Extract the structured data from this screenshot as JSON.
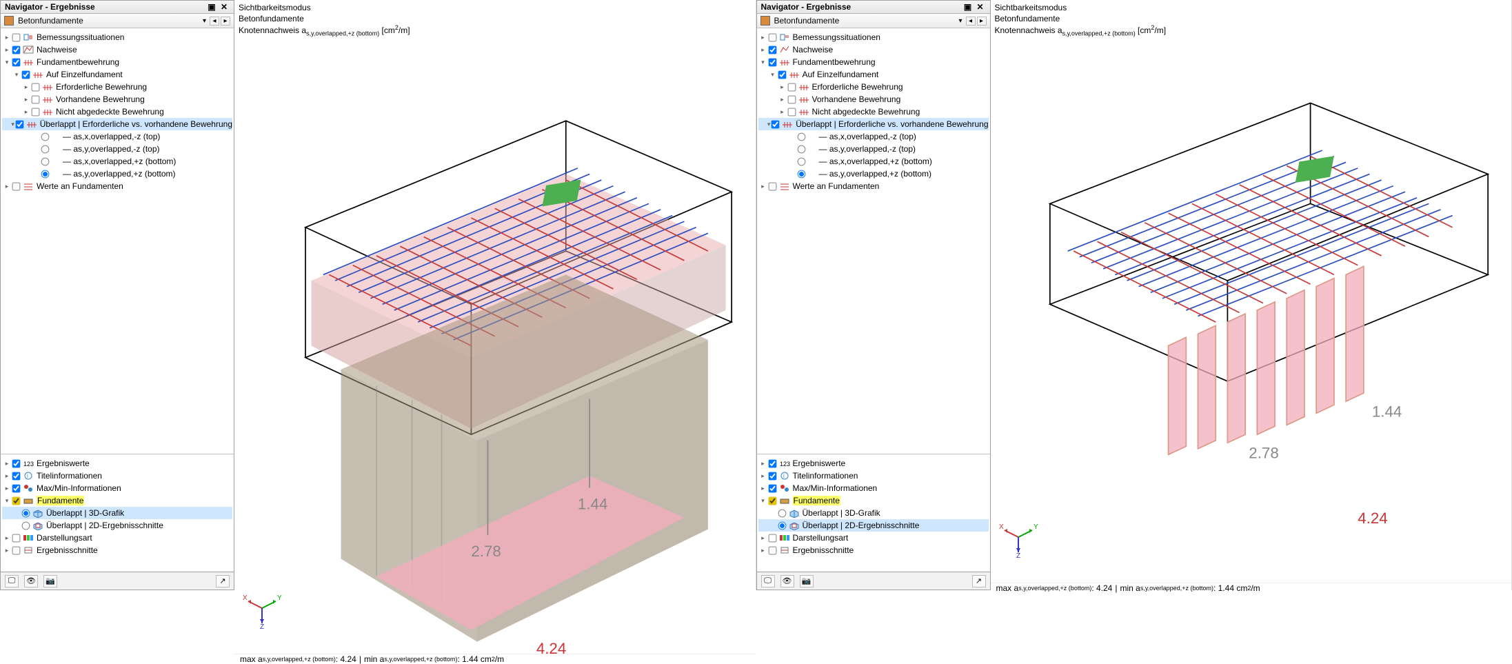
{
  "panel": {
    "title": "Navigator - Ergebnisse",
    "dropdown": "Betonfundamente"
  },
  "tree_top": {
    "bemessung": "Bemessungssituationen",
    "nachweise": "Nachweise",
    "fundbew": "Fundamentbewehrung",
    "auf_einzel": "Auf Einzelfundament",
    "erf_bew": "Erforderliche Bewehrung",
    "vor_bew": "Vorhandene Bewehrung",
    "nicht_abg": "Nicht abgedeckte Bewehrung",
    "ueberlappt": "Überlappt | Erforderliche vs. vorhandene Bewehrung",
    "r1": "as,x,overlapped,-z (top)",
    "r2": "as,y,overlapped,-z (top)",
    "r3": "as,x,overlapped,+z (bottom)",
    "r4": "as,y,overlapped,+z (bottom)",
    "werte": "Werte an Fundamenten"
  },
  "tree_bottom": {
    "ergebnis": "Ergebniswerte",
    "titelinfo": "Titelinformationen",
    "maxmin": "Max/Min-Informationen",
    "fundamente": "Fundamente",
    "u3d": "Überlappt | 3D-Grafik",
    "u2d": "Überlappt | 2D-Ergebnisschnitte",
    "darstell": "Darstellungsart",
    "ergschnitte": "Ergebnisschnitte"
  },
  "viewport": {
    "line1": "Sichtbarkeitsmodus",
    "line2": "Betonfundamente",
    "line3_prefix": "Knotennachweis a",
    "line3_sub": "s,y,overlapped,+z (bottom)",
    "line3_unit_pre": " [cm",
    "line3_unit_exp": "2",
    "line3_unit_post": "/m]",
    "footer_max_label_pre": "max a",
    "footer_sub": "s,y,overlapped,+z (bottom)",
    "footer_max_val": " : 4.24",
    "footer_min_label_pre": "min a",
    "footer_min_val": " : 1.44 cm",
    "footer_exp": "2",
    "footer_post": "/m",
    "val_a": "2.78",
    "val_b": "1.44",
    "val_c": "4.24",
    "ax_x": "X",
    "ax_y": "Y",
    "ax_z": "Z"
  }
}
